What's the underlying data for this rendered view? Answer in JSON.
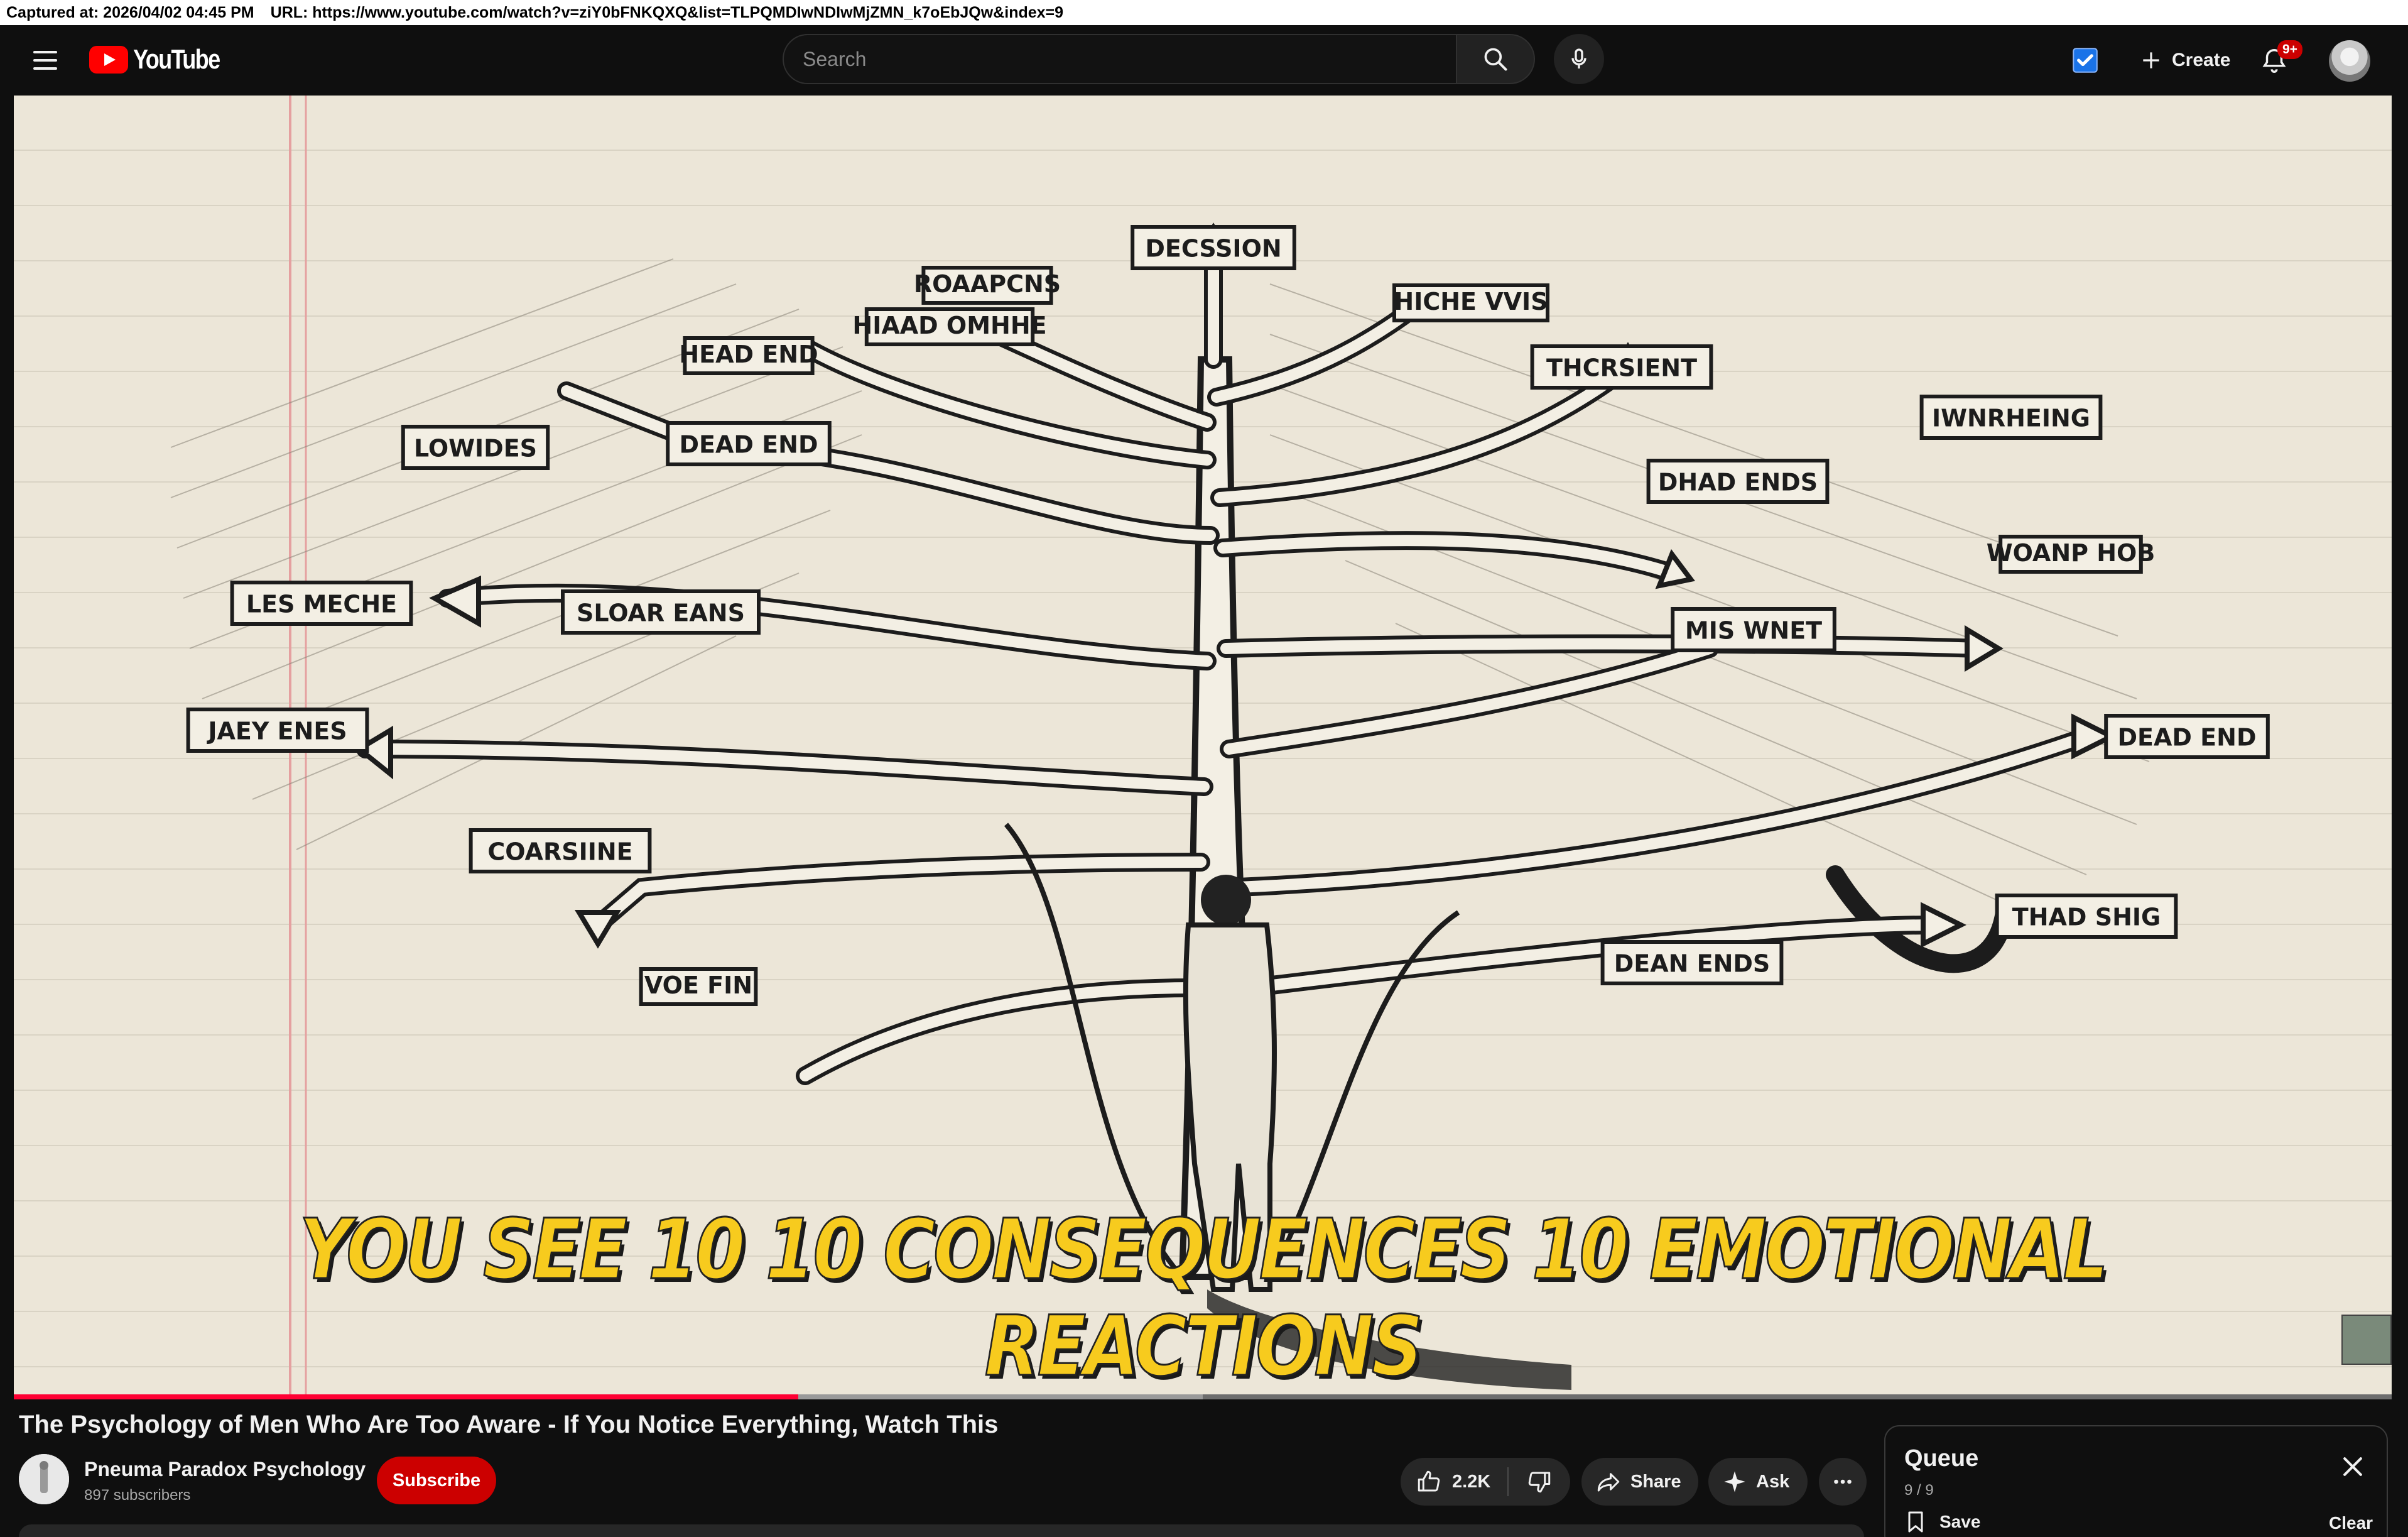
{
  "capture": {
    "captured_at": "Captured at: 2026/04/02 04:45 PM",
    "url": "URL: https://www.youtube.com/watch?v=ziY0bFNKQXQ&list=TLPQMDIwNDIwMjZMN_k7oEbJQw&index=9"
  },
  "masthead": {
    "logo_text": "YouTube",
    "search_placeholder": "Search",
    "create_label": "Create",
    "notification_badge": "9+",
    "icons": [
      "menu-icon",
      "search-icon",
      "mic-icon",
      "studio-check-icon",
      "plus-icon",
      "bell-icon",
      "avatar"
    ]
  },
  "player": {
    "nodes": [
      "DECSSION",
      "ROAAPCNS",
      "HIAAD OMHHE",
      "HICHE VVIS",
      "HEAD END",
      "THCRSIENT",
      "IWNRHEING",
      "LOWIDES",
      "DEAD END",
      "DHAD ENDS",
      "WOANP HOB",
      "LES MECHE",
      "SLOAR EANS",
      "MIS WNET",
      "JAEY ENES",
      "DEAD END",
      "COARSIINE",
      "THAD SHIG",
      "VOE FIN",
      "DEAN ENDS"
    ],
    "caption": "YOU SEE 10 10 CONSEQUENCES 10 EMOTIONAL REACTIONS",
    "progress_played_fraction": 0.33,
    "progress_buffered_fraction": 0.5
  },
  "video": {
    "title": "The Psychology of Men Who Are Too Aware - If You Notice Everything, Watch This",
    "channel_name": "Pneuma Paradox Psychology",
    "subscribers": "897 subscribers",
    "subscribe_label": "Subscribe",
    "likes": "2.2K",
    "share_label": "Share",
    "ask_label": "Ask"
  },
  "queue": {
    "title": "Queue",
    "position": "9 / 9",
    "save_label": "Save",
    "clear_label": "Clear"
  },
  "colors": {
    "brand_red": "#ff0000",
    "subscribe_red": "#cc0000",
    "progress_red": "#ff0033",
    "caption_yellow": "#f7cb1e",
    "paper": "#ece6d8"
  }
}
